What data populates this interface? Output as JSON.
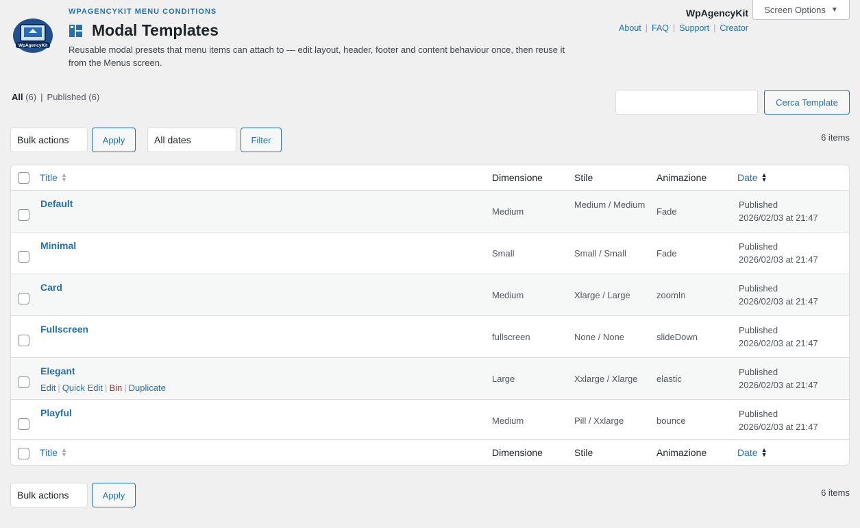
{
  "header": {
    "eyebrow": "WPAGENCYKIT MENU CONDITIONS",
    "title": "Modal Templates",
    "description": "Reusable modal presets that menu items can attach to — edit layout, header, footer and content behaviour once, then reuse it from the Menus screen.",
    "brand": "WpAgencyKit",
    "logo_text": "WpAgencyKit",
    "links": [
      "About",
      "FAQ",
      "Support",
      "Creator"
    ],
    "screen_options": "Screen Options"
  },
  "filters": {
    "all_label": "All",
    "all_count": "(6)",
    "published_label": "Published",
    "published_count": "(6)",
    "search_value": "",
    "search_button": "Cerca Template",
    "bulk_actions": "Bulk actions",
    "apply": "Apply",
    "dates": "All dates",
    "filter": "Filter",
    "items_count": "6 items"
  },
  "columns": {
    "title": "Title",
    "dimensione": "Dimensione",
    "stile": "Stile",
    "animazione": "Animazione",
    "date": "Date"
  },
  "row_actions": {
    "edit": "Edit",
    "quick_edit": "Quick Edit",
    "bin": "Bin",
    "duplicate": "Duplicate"
  },
  "rows": [
    {
      "title": "Default",
      "dimensione": "Medium",
      "stile": "Medium / Medium",
      "animazione": "Fade",
      "status": "Published",
      "date": "2026/02/03 at 21:47"
    },
    {
      "title": "Minimal",
      "dimensione": "Small",
      "stile": "Small / Small",
      "animazione": "Fade",
      "status": "Published",
      "date": "2026/02/03 at 21:47"
    },
    {
      "title": "Card",
      "dimensione": "Medium",
      "stile": "Xlarge / Large",
      "animazione": "zoomIn",
      "status": "Published",
      "date": "2026/02/03 at 21:47"
    },
    {
      "title": "Fullscreen",
      "dimensione": "fullscreen",
      "stile": "None / None",
      "animazione": "slideDown",
      "status": "Published",
      "date": "2026/02/03 at 21:47"
    },
    {
      "title": "Elegant",
      "dimensione": "Large",
      "stile": "Xxlarge / Xlarge",
      "animazione": "elastic",
      "status": "Published",
      "date": "2026/02/03 at 21:47"
    },
    {
      "title": "Playful",
      "dimensione": "Medium",
      "stile": "Pill / Xxlarge",
      "animazione": "bounce",
      "status": "Published",
      "date": "2026/02/03 at 21:47"
    }
  ],
  "colors": {
    "accent": "#2271b1",
    "background": "#f0f0f1",
    "danger": "#b32d2e"
  }
}
